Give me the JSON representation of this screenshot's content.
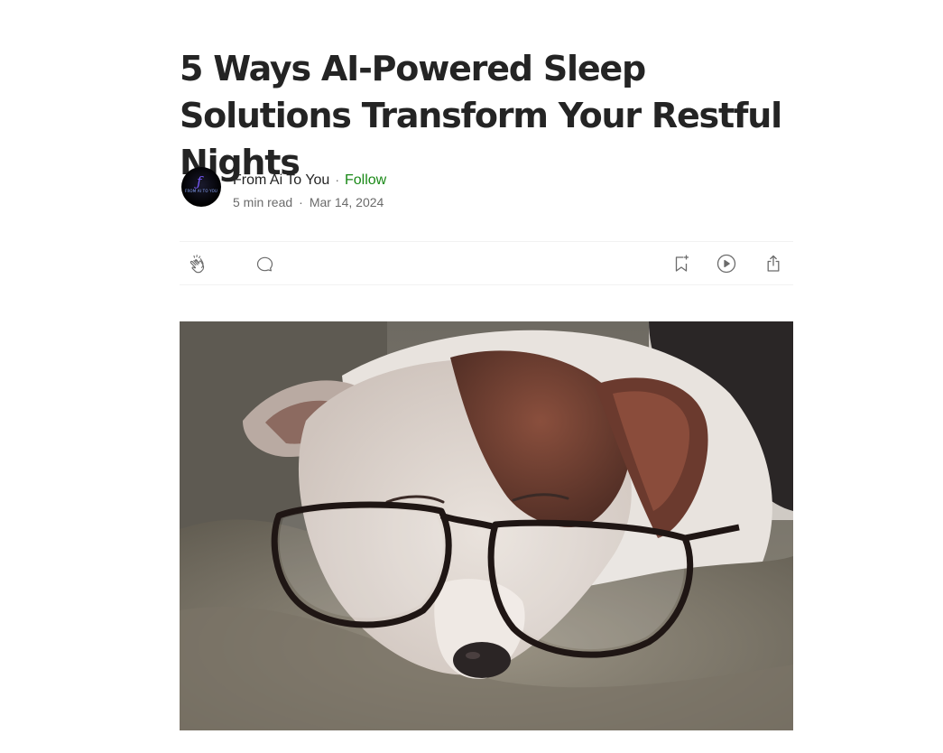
{
  "article": {
    "title": "5 Ways AI-Powered Sleep Solutions Transform Your Restful Nights",
    "author": {
      "name": "From Ai To You",
      "avatar_text": "FROM AI TO YOU",
      "follow_label": "Follow"
    },
    "meta": {
      "read_time": "5 min read",
      "separator": "·",
      "date": "Mar 14, 2024"
    }
  },
  "actions": {
    "left": [
      "clap-icon",
      "comment-icon"
    ],
    "right": [
      "bookmark-add-icon",
      "listen-play-icon",
      "share-icon"
    ]
  },
  "colors": {
    "text": "#242424",
    "muted": "#6b6b6b",
    "follow": "#1a8917",
    "divider": "#f2f2f2"
  }
}
